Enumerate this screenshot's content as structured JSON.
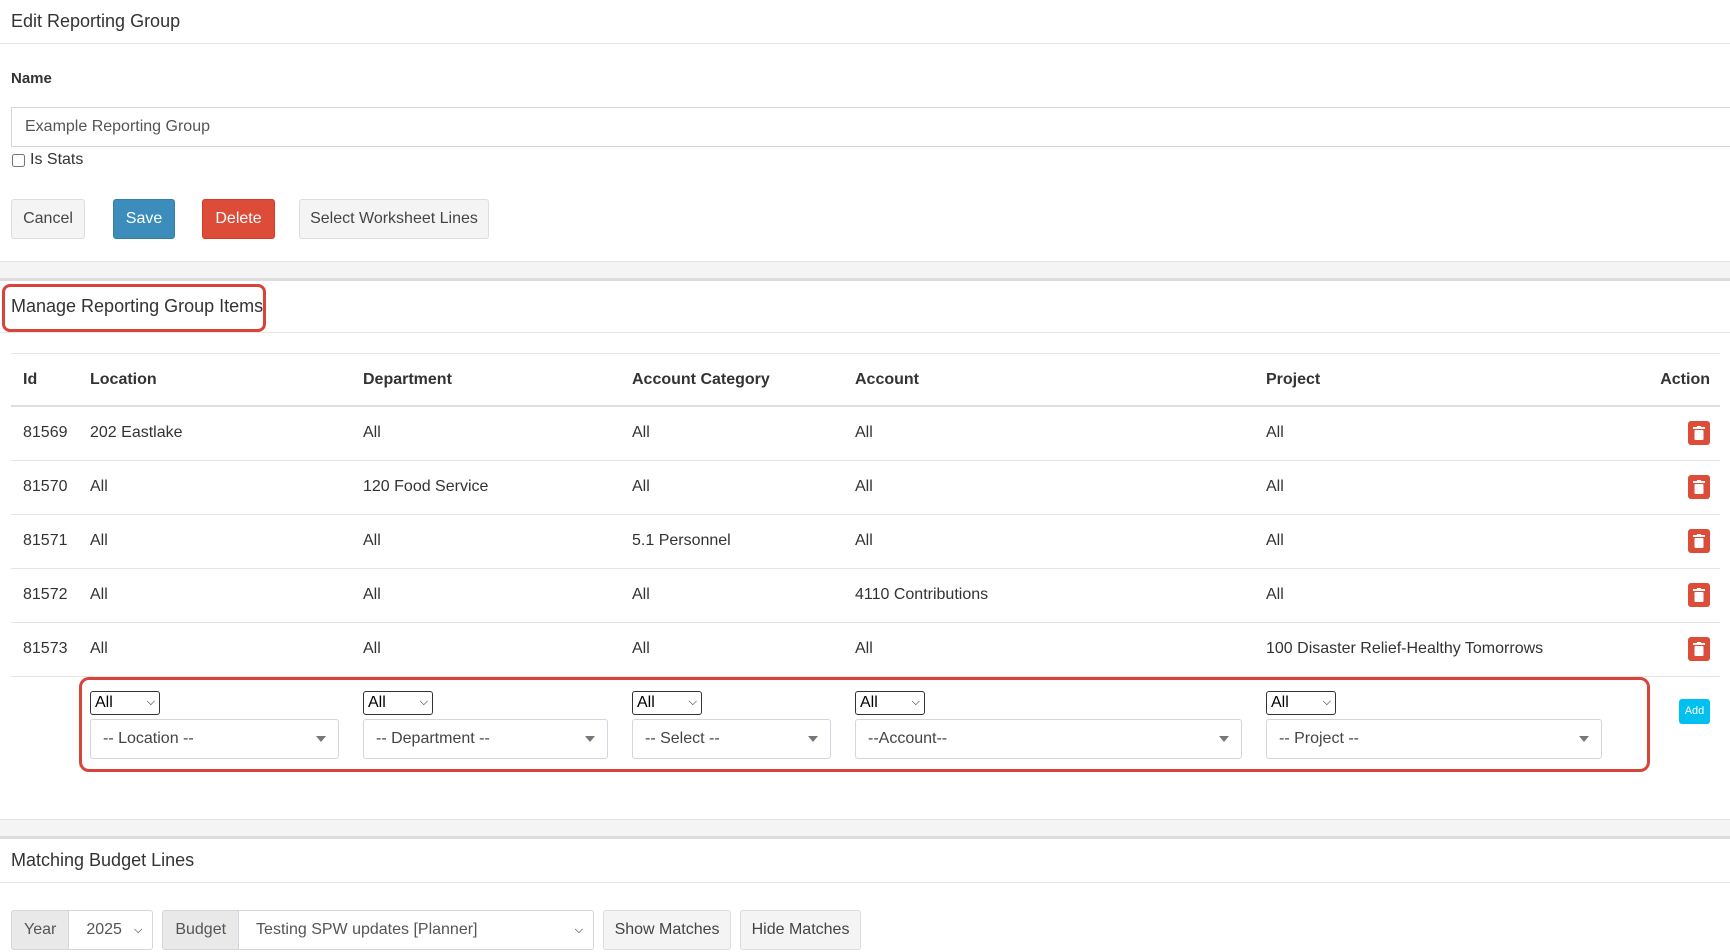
{
  "edit_panel": {
    "title": "Edit Reporting Group",
    "name_label": "Name",
    "name_value": "Example Reporting Group",
    "is_stats_label": "Is Stats",
    "is_stats_checked": false,
    "buttons": {
      "cancel": "Cancel",
      "save": "Save",
      "delete": "Delete",
      "select_worksheet": "Select Worksheet Lines"
    },
    "colors": {
      "primary": "#3c8dbc",
      "danger": "#dd4b39",
      "info": "#00c0ef",
      "highlight": "#d9443a"
    }
  },
  "manage_panel": {
    "title": "Manage Reporting Group Items",
    "columns": [
      "Id",
      "Location",
      "Department",
      "Account Category",
      "Account",
      "Project",
      "Action"
    ],
    "rows": [
      {
        "id": "81569",
        "location": "202 Eastlake",
        "department": "All",
        "account_category": "All",
        "account": "All",
        "project": "All"
      },
      {
        "id": "81570",
        "location": "All",
        "department": "120 Food Service",
        "account_category": "All",
        "account": "All",
        "project": "All"
      },
      {
        "id": "81571",
        "location": "All",
        "department": "All",
        "account_category": "5.1 Personnel",
        "account": "All",
        "project": "All"
      },
      {
        "id": "81572",
        "location": "All",
        "department": "All",
        "account_category": "All",
        "account": "4110 Contributions",
        "project": "All"
      },
      {
        "id": "81573",
        "location": "All",
        "department": "All",
        "account_category": "All",
        "account": "All",
        "project": "100 Disaster Relief-Healthy Tomorrows"
      }
    ],
    "row_action_icon": "trash-icon",
    "add_row": {
      "location": {
        "mode": "All",
        "placeholder": "-- Location --"
      },
      "department": {
        "mode": "All",
        "placeholder": "-- Department --"
      },
      "account_category": {
        "mode": "All",
        "placeholder": "-- Select --"
      },
      "account": {
        "mode": "All",
        "placeholder": "--Account--"
      },
      "project": {
        "mode": "All",
        "placeholder": "-- Project --"
      },
      "add_label": "Add"
    }
  },
  "matching_panel": {
    "title": "Matching Budget Lines",
    "year_label": "Year",
    "year_value": "2025",
    "budget_label": "Budget",
    "budget_value": "Testing SPW updates [Planner]",
    "show_matches": "Show Matches",
    "hide_matches": "Hide Matches"
  }
}
